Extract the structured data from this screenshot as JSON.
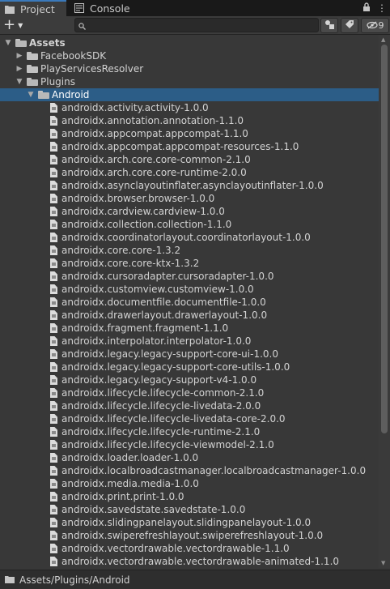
{
  "tabs": [
    {
      "label": "Project",
      "icon": "folder-icon",
      "active": true
    },
    {
      "label": "Console",
      "icon": "console-icon",
      "active": false
    }
  ],
  "toolbar": {
    "add_label": "+",
    "search_value": "",
    "search_placeholder": "",
    "hidden_count": "9"
  },
  "tree": [
    {
      "label": "Assets",
      "type": "folder",
      "depth": 0,
      "expanded": true,
      "bold": true
    },
    {
      "label": "FacebookSDK",
      "type": "folder",
      "depth": 1,
      "expanded": false
    },
    {
      "label": "PlayServicesResolver",
      "type": "folder",
      "depth": 1,
      "expanded": false
    },
    {
      "label": "Plugins",
      "type": "folder",
      "depth": 1,
      "expanded": true
    },
    {
      "label": "Android",
      "type": "folder",
      "depth": 2,
      "expanded": true,
      "selected": true
    },
    {
      "label": "androidx.activity.activity-1.0.0",
      "type": "file",
      "depth": 3
    },
    {
      "label": "androidx.annotation.annotation-1.1.0",
      "type": "file",
      "depth": 3
    },
    {
      "label": "androidx.appcompat.appcompat-1.1.0",
      "type": "file",
      "depth": 3
    },
    {
      "label": "androidx.appcompat.appcompat-resources-1.1.0",
      "type": "file",
      "depth": 3
    },
    {
      "label": "androidx.arch.core.core-common-2.1.0",
      "type": "file",
      "depth": 3
    },
    {
      "label": "androidx.arch.core.core-runtime-2.0.0",
      "type": "file",
      "depth": 3
    },
    {
      "label": "androidx.asynclayoutinflater.asynclayoutinflater-1.0.0",
      "type": "file",
      "depth": 3
    },
    {
      "label": "androidx.browser.browser-1.0.0",
      "type": "file",
      "depth": 3
    },
    {
      "label": "androidx.cardview.cardview-1.0.0",
      "type": "file",
      "depth": 3
    },
    {
      "label": "androidx.collection.collection-1.1.0",
      "type": "file",
      "depth": 3
    },
    {
      "label": "androidx.coordinatorlayout.coordinatorlayout-1.0.0",
      "type": "file",
      "depth": 3
    },
    {
      "label": "androidx.core.core-1.3.2",
      "type": "file",
      "depth": 3
    },
    {
      "label": "androidx.core.core-ktx-1.3.2",
      "type": "file",
      "depth": 3
    },
    {
      "label": "androidx.cursoradapter.cursoradapter-1.0.0",
      "type": "file",
      "depth": 3
    },
    {
      "label": "androidx.customview.customview-1.0.0",
      "type": "file",
      "depth": 3
    },
    {
      "label": "androidx.documentfile.documentfile-1.0.0",
      "type": "file",
      "depth": 3
    },
    {
      "label": "androidx.drawerlayout.drawerlayout-1.0.0",
      "type": "file",
      "depth": 3
    },
    {
      "label": "androidx.fragment.fragment-1.1.0",
      "type": "file",
      "depth": 3
    },
    {
      "label": "androidx.interpolator.interpolator-1.0.0",
      "type": "file",
      "depth": 3
    },
    {
      "label": "androidx.legacy.legacy-support-core-ui-1.0.0",
      "type": "file",
      "depth": 3
    },
    {
      "label": "androidx.legacy.legacy-support-core-utils-1.0.0",
      "type": "file",
      "depth": 3
    },
    {
      "label": "androidx.legacy.legacy-support-v4-1.0.0",
      "type": "file",
      "depth": 3
    },
    {
      "label": "androidx.lifecycle.lifecycle-common-2.1.0",
      "type": "file",
      "depth": 3
    },
    {
      "label": "androidx.lifecycle.lifecycle-livedata-2.0.0",
      "type": "file",
      "depth": 3
    },
    {
      "label": "androidx.lifecycle.lifecycle-livedata-core-2.0.0",
      "type": "file",
      "depth": 3
    },
    {
      "label": "androidx.lifecycle.lifecycle-runtime-2.1.0",
      "type": "file",
      "depth": 3
    },
    {
      "label": "androidx.lifecycle.lifecycle-viewmodel-2.1.0",
      "type": "file",
      "depth": 3
    },
    {
      "label": "androidx.loader.loader-1.0.0",
      "type": "file",
      "depth": 3
    },
    {
      "label": "androidx.localbroadcastmanager.localbroadcastmanager-1.0.0",
      "type": "file",
      "depth": 3
    },
    {
      "label": "androidx.media.media-1.0.0",
      "type": "file",
      "depth": 3
    },
    {
      "label": "androidx.print.print-1.0.0",
      "type": "file",
      "depth": 3
    },
    {
      "label": "androidx.savedstate.savedstate-1.0.0",
      "type": "file",
      "depth": 3
    },
    {
      "label": "androidx.slidingpanelayout.slidingpanelayout-1.0.0",
      "type": "file",
      "depth": 3
    },
    {
      "label": "androidx.swiperefreshlayout.swiperefreshlayout-1.0.0",
      "type": "file",
      "depth": 3
    },
    {
      "label": "androidx.vectordrawable.vectordrawable-1.1.0",
      "type": "file",
      "depth": 3
    },
    {
      "label": "androidx.vectordrawable.vectordrawable-animated-1.1.0",
      "type": "file",
      "depth": 3
    }
  ],
  "status": {
    "path": "Assets/Plugins/Android"
  },
  "colors": {
    "selection": "#2c5d87",
    "tab_accent": "#3a79bb",
    "background": "#383838"
  }
}
